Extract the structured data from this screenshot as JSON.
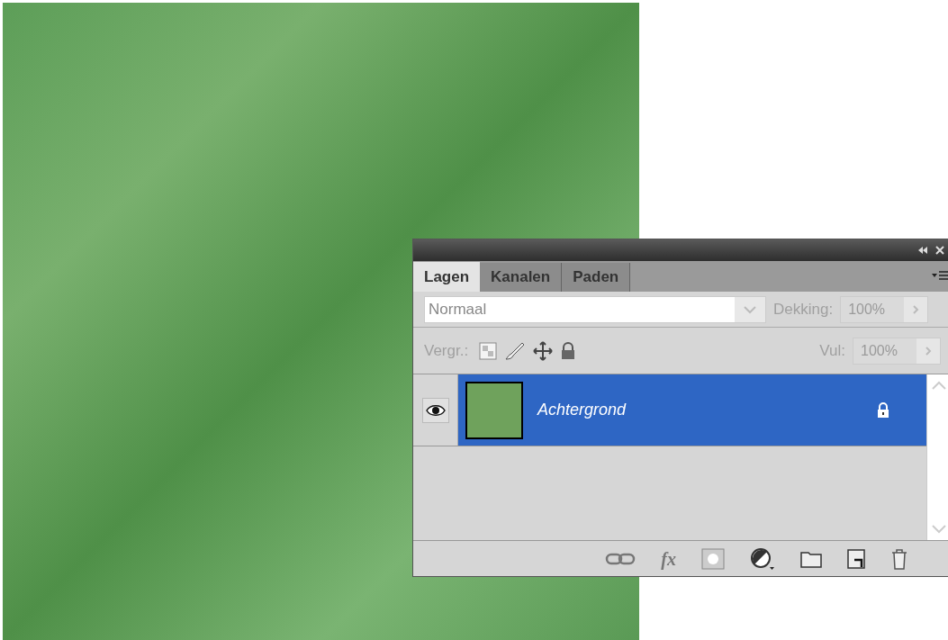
{
  "panel": {
    "tabs": [
      {
        "label": "Lagen",
        "selected": true
      },
      {
        "label": "Kanalen",
        "selected": false
      },
      {
        "label": "Paden",
        "selected": false
      }
    ],
    "blend_mode": {
      "value": "Normaal"
    },
    "opacity": {
      "label": "Dekking:",
      "value": "100%"
    },
    "lock": {
      "label": "Vergr.:"
    },
    "fill": {
      "label": "Vul:",
      "value": "100%"
    },
    "layers": [
      {
        "name": "Achtergrond",
        "selected": true,
        "visible": true,
        "locked": true
      }
    ],
    "footer": {
      "fx": "fx"
    }
  }
}
